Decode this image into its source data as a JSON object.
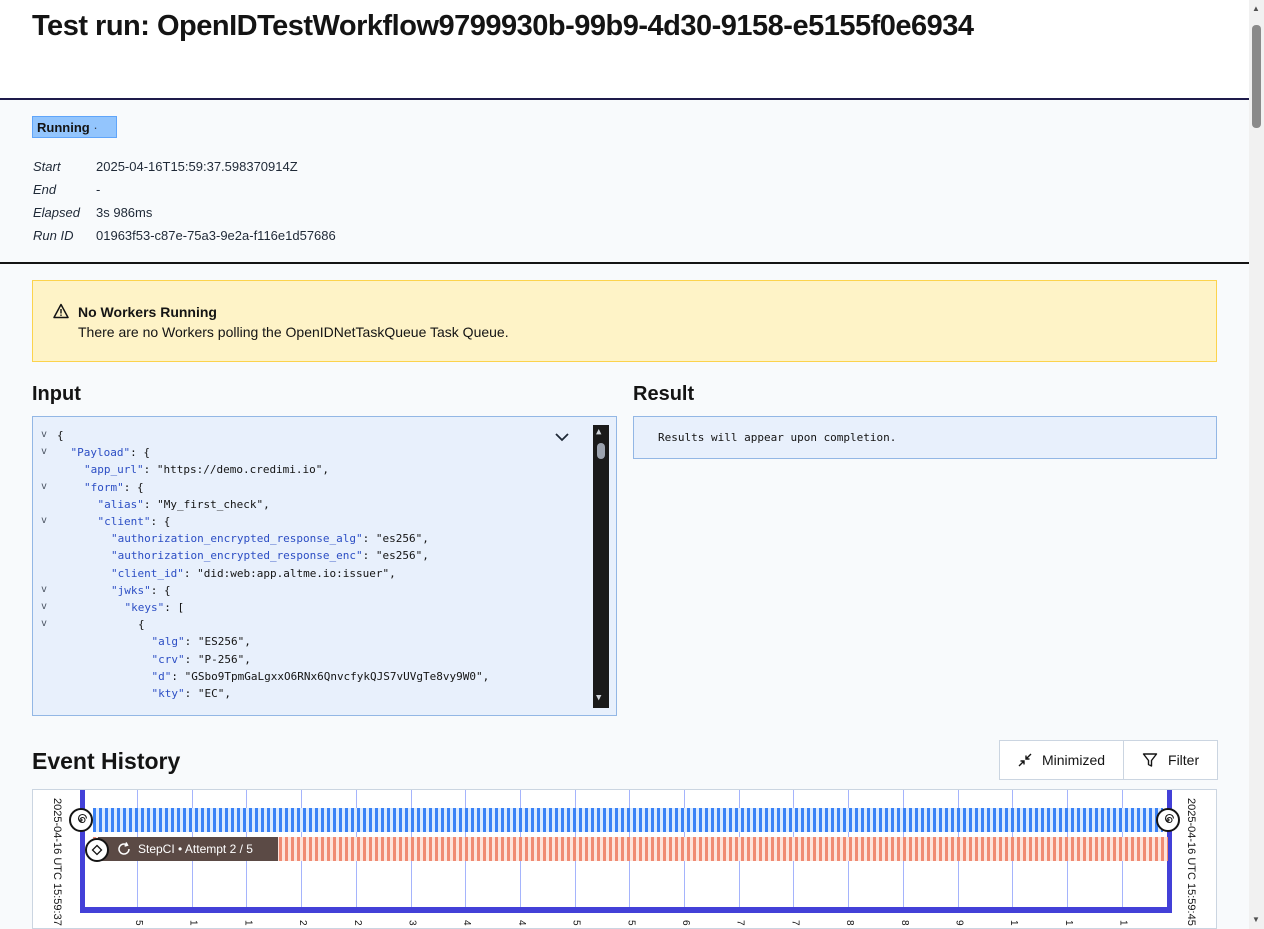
{
  "header": {
    "title": "Test run: OpenIDTestWorkflow9799930b-99b9-4d30-9158-e5155f0e6934"
  },
  "summary": {
    "status": "Running",
    "status_dot": "·",
    "start_label": "Start",
    "start_value": "2025-04-16T15:59:37.598370914Z",
    "end_label": "End",
    "end_value": "-",
    "elapsed_label": "Elapsed",
    "elapsed_value": "3s 986ms",
    "runid_label": "Run ID",
    "runid_value": "01963f53-c87e-75a3-9e2a-f116e1d57686"
  },
  "alert": {
    "title": "No Workers Running",
    "text": "There are no Workers polling the OpenIDNetTaskQueue Task Queue."
  },
  "input": {
    "heading": "Input",
    "lines": [
      {
        "fold": "v",
        "indent": 0,
        "key": "",
        "text": "{"
      },
      {
        "fold": "v",
        "indent": 1,
        "key": "\"Payload\"",
        "text": ": {"
      },
      {
        "fold": "",
        "indent": 2,
        "key": "\"app_url\"",
        "text": ": \"https://demo.credimi.io\","
      },
      {
        "fold": "v",
        "indent": 2,
        "key": "\"form\"",
        "text": ": {"
      },
      {
        "fold": "",
        "indent": 3,
        "key": "\"alias\"",
        "text": ": \"My_first_check\","
      },
      {
        "fold": "v",
        "indent": 3,
        "key": "\"client\"",
        "text": ": {"
      },
      {
        "fold": "",
        "indent": 4,
        "key": "\"authorization_encrypted_response_alg\"",
        "text": ": \"es256\","
      },
      {
        "fold": "",
        "indent": 4,
        "key": "\"authorization_encrypted_response_enc\"",
        "text": ": \"es256\","
      },
      {
        "fold": "",
        "indent": 4,
        "key": "\"client_id\"",
        "text": ": \"did:web:app.altme.io:issuer\","
      },
      {
        "fold": "v",
        "indent": 4,
        "key": "\"jwks\"",
        "text": ": {"
      },
      {
        "fold": "v",
        "indent": 5,
        "key": "\"keys\"",
        "text": ": ["
      },
      {
        "fold": "v",
        "indent": 6,
        "key": "",
        "text": "{"
      },
      {
        "fold": "",
        "indent": 7,
        "key": "\"alg\"",
        "text": ": \"ES256\","
      },
      {
        "fold": "",
        "indent": 7,
        "key": "\"crv\"",
        "text": ": \"P-256\","
      },
      {
        "fold": "",
        "indent": 7,
        "key": "\"d\"",
        "text": ": \"GSbo9TpmGaLgxxO6RNx6QnvcfykQJS7vUVgTe8vy9W0\","
      },
      {
        "fold": "",
        "indent": 7,
        "key": "\"kty\"",
        "text": ": \"EC\","
      }
    ]
  },
  "result": {
    "heading": "Result",
    "text": "Results will appear upon completion."
  },
  "events": {
    "heading": "Event History",
    "minimized_label": "Minimized",
    "filter_label": "Filter",
    "start_time": "2025-04-16 UTC 15:59:37",
    "end_time": "2025-04-16 UTC 15:59:45",
    "activity_label": "StepCI • Attempt 2 / 5",
    "ticks": [
      "5",
      "1",
      "1",
      "2",
      "2",
      "3",
      "4",
      "4",
      "5",
      "5",
      "6",
      "7",
      "7",
      "8",
      "8",
      "9",
      "1",
      "1",
      "1"
    ]
  },
  "colors": {
    "accent": "#4340d8",
    "status_running": "#93c5fd",
    "alert_bg": "#fef3c7",
    "workflow_bar": "#3b82f6",
    "activity_bar": "#f08b73"
  }
}
